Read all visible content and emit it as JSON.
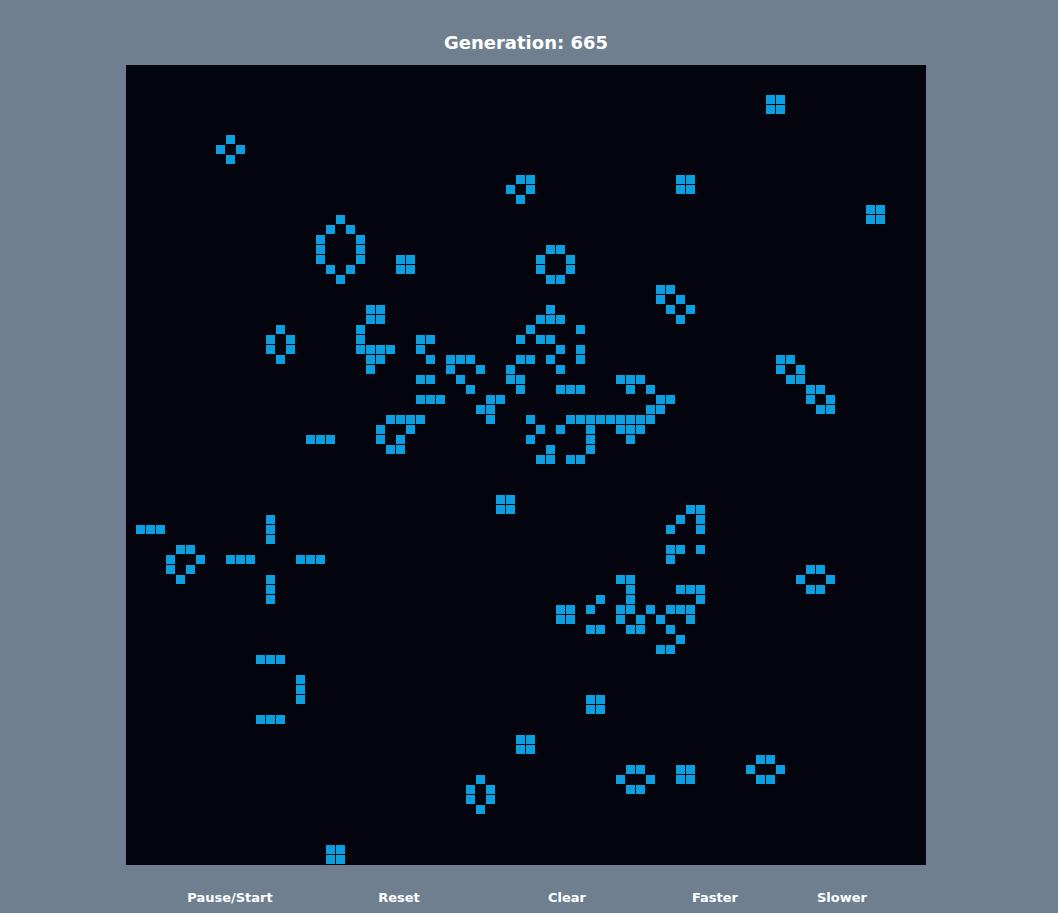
{
  "title": "Generation: 665",
  "grid": {
    "columns": 80,
    "rows": 80,
    "live": [
      [
        64,
        3
      ],
      [
        65,
        3
      ],
      [
        64,
        4
      ],
      [
        65,
        4
      ],
      [
        10,
        7
      ],
      [
        9,
        8
      ],
      [
        11,
        8
      ],
      [
        10,
        9
      ],
      [
        39,
        11
      ],
      [
        40,
        11
      ],
      [
        38,
        12
      ],
      [
        40,
        12
      ],
      [
        39,
        13
      ],
      [
        55,
        11
      ],
      [
        56,
        11
      ],
      [
        55,
        12
      ],
      [
        56,
        12
      ],
      [
        74,
        14
      ],
      [
        75,
        14
      ],
      [
        74,
        15
      ],
      [
        75,
        15
      ],
      [
        21,
        15
      ],
      [
        20,
        16
      ],
      [
        22,
        16
      ],
      [
        19,
        17
      ],
      [
        23,
        17
      ],
      [
        19,
        18
      ],
      [
        23,
        18
      ],
      [
        19,
        19
      ],
      [
        23,
        19
      ],
      [
        20,
        20
      ],
      [
        22,
        20
      ],
      [
        21,
        21
      ],
      [
        27,
        19
      ],
      [
        28,
        19
      ],
      [
        27,
        20
      ],
      [
        28,
        20
      ],
      [
        42,
        18
      ],
      [
        43,
        18
      ],
      [
        41,
        19
      ],
      [
        44,
        19
      ],
      [
        41,
        20
      ],
      [
        44,
        20
      ],
      [
        42,
        21
      ],
      [
        43,
        21
      ],
      [
        53,
        22
      ],
      [
        54,
        22
      ],
      [
        53,
        23
      ],
      [
        55,
        23
      ],
      [
        54,
        24
      ],
      [
        56,
        24
      ],
      [
        55,
        25
      ],
      [
        15,
        26
      ],
      [
        14,
        27
      ],
      [
        16,
        27
      ],
      [
        14,
        28
      ],
      [
        16,
        28
      ],
      [
        15,
        29
      ],
      [
        24,
        24
      ],
      [
        25,
        24
      ],
      [
        24,
        25
      ],
      [
        25,
        25
      ],
      [
        23,
        26
      ],
      [
        23,
        27
      ],
      [
        23,
        28
      ],
      [
        24,
        28
      ],
      [
        25,
        28
      ],
      [
        26,
        28
      ],
      [
        24,
        29
      ],
      [
        25,
        29
      ],
      [
        24,
        30
      ],
      [
        29,
        27
      ],
      [
        30,
        27
      ],
      [
        29,
        28
      ],
      [
        30,
        29
      ],
      [
        29,
        31
      ],
      [
        30,
        31
      ],
      [
        29,
        33
      ],
      [
        30,
        33
      ],
      [
        31,
        33
      ],
      [
        32,
        29
      ],
      [
        33,
        29
      ],
      [
        34,
        29
      ],
      [
        32,
        30
      ],
      [
        35,
        30
      ],
      [
        33,
        31
      ],
      [
        34,
        32
      ],
      [
        39,
        29
      ],
      [
        40,
        29
      ],
      [
        38,
        30
      ],
      [
        38,
        31
      ],
      [
        39,
        31
      ],
      [
        39,
        32
      ],
      [
        36,
        33
      ],
      [
        37,
        33
      ],
      [
        35,
        34
      ],
      [
        36,
        34
      ],
      [
        36,
        35
      ],
      [
        42,
        24
      ],
      [
        41,
        25
      ],
      [
        42,
        25
      ],
      [
        43,
        25
      ],
      [
        40,
        26
      ],
      [
        45,
        26
      ],
      [
        39,
        27
      ],
      [
        41,
        27
      ],
      [
        42,
        27
      ],
      [
        43,
        28
      ],
      [
        45,
        28
      ],
      [
        42,
        29
      ],
      [
        45,
        29
      ],
      [
        43,
        30
      ],
      [
        43,
        32
      ],
      [
        44,
        32
      ],
      [
        45,
        32
      ],
      [
        49,
        31
      ],
      [
        50,
        31
      ],
      [
        51,
        31
      ],
      [
        50,
        32
      ],
      [
        52,
        32
      ],
      [
        53,
        33
      ],
      [
        54,
        33
      ],
      [
        52,
        34
      ],
      [
        53,
        34
      ],
      [
        40,
        35
      ],
      [
        44,
        35
      ],
      [
        45,
        35
      ],
      [
        46,
        35
      ],
      [
        47,
        35
      ],
      [
        48,
        35
      ],
      [
        49,
        35
      ],
      [
        50,
        35
      ],
      [
        51,
        35
      ],
      [
        52,
        35
      ],
      [
        41,
        36
      ],
      [
        43,
        36
      ],
      [
        46,
        36
      ],
      [
        49,
        36
      ],
      [
        50,
        36
      ],
      [
        51,
        36
      ],
      [
        40,
        37
      ],
      [
        46,
        37
      ],
      [
        50,
        37
      ],
      [
        42,
        38
      ],
      [
        46,
        38
      ],
      [
        41,
        39
      ],
      [
        42,
        39
      ],
      [
        44,
        39
      ],
      [
        45,
        39
      ],
      [
        26,
        35
      ],
      [
        27,
        35
      ],
      [
        28,
        35
      ],
      [
        29,
        35
      ],
      [
        25,
        36
      ],
      [
        28,
        36
      ],
      [
        25,
        37
      ],
      [
        27,
        37
      ],
      [
        26,
        38
      ],
      [
        27,
        38
      ],
      [
        18,
        37
      ],
      [
        19,
        37
      ],
      [
        20,
        37
      ],
      [
        37,
        43
      ],
      [
        38,
        43
      ],
      [
        37,
        44
      ],
      [
        38,
        44
      ],
      [
        1,
        46
      ],
      [
        2,
        46
      ],
      [
        3,
        46
      ],
      [
        5,
        48
      ],
      [
        6,
        48
      ],
      [
        4,
        49
      ],
      [
        7,
        49
      ],
      [
        4,
        50
      ],
      [
        6,
        50
      ],
      [
        5,
        51
      ],
      [
        14,
        45
      ],
      [
        14,
        46
      ],
      [
        14,
        47
      ],
      [
        10,
        49
      ],
      [
        11,
        49
      ],
      [
        12,
        49
      ],
      [
        17,
        49
      ],
      [
        18,
        49
      ],
      [
        19,
        49
      ],
      [
        14,
        51
      ],
      [
        14,
        52
      ],
      [
        14,
        53
      ],
      [
        56,
        44
      ],
      [
        57,
        44
      ],
      [
        55,
        45
      ],
      [
        57,
        45
      ],
      [
        54,
        46
      ],
      [
        57,
        46
      ],
      [
        54,
        48
      ],
      [
        55,
        48
      ],
      [
        57,
        48
      ],
      [
        54,
        49
      ],
      [
        68,
        50
      ],
      [
        69,
        50
      ],
      [
        67,
        51
      ],
      [
        70,
        51
      ],
      [
        68,
        52
      ],
      [
        69,
        52
      ],
      [
        43,
        54
      ],
      [
        44,
        54
      ],
      [
        43,
        55
      ],
      [
        44,
        55
      ],
      [
        49,
        51
      ],
      [
        50,
        51
      ],
      [
        50,
        52
      ],
      [
        55,
        52
      ],
      [
        56,
        52
      ],
      [
        57,
        52
      ],
      [
        47,
        53
      ],
      [
        50,
        53
      ],
      [
        57,
        53
      ],
      [
        46,
        54
      ],
      [
        49,
        54
      ],
      [
        50,
        54
      ],
      [
        52,
        54
      ],
      [
        54,
        54
      ],
      [
        55,
        54
      ],
      [
        56,
        54
      ],
      [
        49,
        55
      ],
      [
        51,
        55
      ],
      [
        53,
        55
      ],
      [
        56,
        55
      ],
      [
        46,
        56
      ],
      [
        47,
        56
      ],
      [
        50,
        56
      ],
      [
        51,
        56
      ],
      [
        54,
        56
      ],
      [
        55,
        57
      ],
      [
        53,
        58
      ],
      [
        54,
        58
      ],
      [
        13,
        59
      ],
      [
        14,
        59
      ],
      [
        15,
        59
      ],
      [
        17,
        61
      ],
      [
        17,
        62
      ],
      [
        17,
        63
      ],
      [
        13,
        65
      ],
      [
        14,
        65
      ],
      [
        15,
        65
      ],
      [
        46,
        63
      ],
      [
        47,
        63
      ],
      [
        46,
        64
      ],
      [
        47,
        64
      ],
      [
        39,
        67
      ],
      [
        40,
        67
      ],
      [
        39,
        68
      ],
      [
        40,
        68
      ],
      [
        50,
        70
      ],
      [
        51,
        70
      ],
      [
        49,
        71
      ],
      [
        52,
        71
      ],
      [
        50,
        72
      ],
      [
        51,
        72
      ],
      [
        55,
        70
      ],
      [
        56,
        70
      ],
      [
        55,
        71
      ],
      [
        56,
        71
      ],
      [
        63,
        69
      ],
      [
        64,
        69
      ],
      [
        62,
        70
      ],
      [
        65,
        70
      ],
      [
        63,
        71
      ],
      [
        64,
        71
      ],
      [
        35,
        71
      ],
      [
        34,
        72
      ],
      [
        36,
        72
      ],
      [
        34,
        73
      ],
      [
        36,
        73
      ],
      [
        35,
        74
      ],
      [
        20,
        78
      ],
      [
        21,
        78
      ],
      [
        20,
        79
      ],
      [
        21,
        79
      ],
      [
        65,
        29
      ],
      [
        66,
        29
      ],
      [
        65,
        30
      ],
      [
        67,
        30
      ],
      [
        66,
        31
      ],
      [
        67,
        31
      ],
      [
        68,
        32
      ],
      [
        69,
        32
      ],
      [
        68,
        33
      ],
      [
        70,
        33
      ],
      [
        69,
        34
      ],
      [
        70,
        34
      ]
    ]
  },
  "buttons": [
    "Pause/Start",
    "Reset",
    "Clear",
    "Faster",
    "Slower"
  ]
}
